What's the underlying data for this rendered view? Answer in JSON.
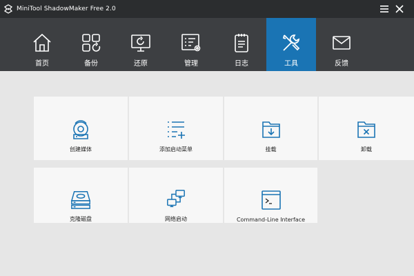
{
  "app": {
    "title": "MiniTool ShadowMaker Free 2.0"
  },
  "colors": {
    "titlebar": "#2b2d2f",
    "navbar": "#3d3f42",
    "accent": "#1a74b4",
    "tile_bg": "#f7f7f7",
    "page_bg": "#e6e6e6"
  },
  "nav": {
    "items": [
      {
        "label": "首页",
        "icon": "home-icon"
      },
      {
        "label": "备份",
        "icon": "backup-icon"
      },
      {
        "label": "还原",
        "icon": "restore-icon"
      },
      {
        "label": "管理",
        "icon": "manage-icon"
      },
      {
        "label": "日志",
        "icon": "log-icon"
      },
      {
        "label": "工具",
        "icon": "tools-icon",
        "active": true
      },
      {
        "label": "反馈",
        "icon": "feedback-icon"
      }
    ]
  },
  "tools": {
    "tiles": [
      {
        "label": "创建媒体",
        "icon": "media-builder-icon"
      },
      {
        "label": "添加启动菜单",
        "icon": "boot-menu-icon"
      },
      {
        "label": "挂载",
        "icon": "mount-icon"
      },
      {
        "label": "卸载",
        "icon": "dismount-icon"
      },
      {
        "label": "克隆磁盘",
        "icon": "clone-disk-icon"
      },
      {
        "label": "网络启动",
        "icon": "network-boot-icon"
      },
      {
        "label": "Command-Line Interface",
        "icon": "command-line-icon"
      }
    ]
  }
}
